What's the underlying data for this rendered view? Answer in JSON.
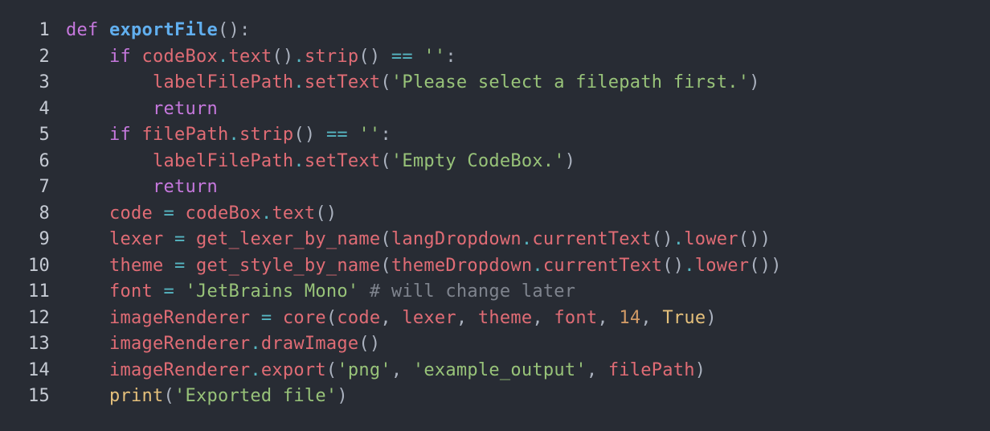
{
  "editor": {
    "language": "python",
    "theme_colors": {
      "background": "#282c34",
      "line_number": "#c5cad3",
      "keyword": "#c678dd",
      "function_def": "#61afef",
      "variable": "#e06c75",
      "punctuation": "#abb2bf",
      "operator": "#56b6c2",
      "string": "#98c379",
      "comment": "#7f848e",
      "number": "#d19a66",
      "builtin": "#e5c07b"
    },
    "lines": [
      {
        "number": "1",
        "tokens": [
          {
            "t": "def",
            "c": "kw"
          },
          {
            "t": " ",
            "c": "plain"
          },
          {
            "t": "exportFile",
            "c": "fn"
          },
          {
            "t": "():",
            "c": "punc"
          }
        ]
      },
      {
        "number": "2",
        "tokens": [
          {
            "t": "    ",
            "c": "plain"
          },
          {
            "t": "if",
            "c": "kw"
          },
          {
            "t": " ",
            "c": "plain"
          },
          {
            "t": "codeBox",
            "c": "var"
          },
          {
            "t": ".",
            "c": "op"
          },
          {
            "t": "text",
            "c": "method"
          },
          {
            "t": "()",
            "c": "punc"
          },
          {
            "t": ".",
            "c": "op"
          },
          {
            "t": "strip",
            "c": "method"
          },
          {
            "t": "()",
            "c": "punc"
          },
          {
            "t": " ",
            "c": "plain"
          },
          {
            "t": "==",
            "c": "op"
          },
          {
            "t": " ",
            "c": "plain"
          },
          {
            "t": "''",
            "c": "str"
          },
          {
            "t": ":",
            "c": "punc"
          }
        ]
      },
      {
        "number": "3",
        "tokens": [
          {
            "t": "        ",
            "c": "plain"
          },
          {
            "t": "labelFilePath",
            "c": "var"
          },
          {
            "t": ".",
            "c": "op"
          },
          {
            "t": "setText",
            "c": "method"
          },
          {
            "t": "(",
            "c": "punc"
          },
          {
            "t": "'Please select a filepath first.'",
            "c": "str"
          },
          {
            "t": ")",
            "c": "punc"
          }
        ]
      },
      {
        "number": "4",
        "tokens": [
          {
            "t": "        ",
            "c": "plain"
          },
          {
            "t": "return",
            "c": "kw"
          }
        ]
      },
      {
        "number": "5",
        "tokens": [
          {
            "t": "    ",
            "c": "plain"
          },
          {
            "t": "if",
            "c": "kw"
          },
          {
            "t": " ",
            "c": "plain"
          },
          {
            "t": "filePath",
            "c": "var"
          },
          {
            "t": ".",
            "c": "op"
          },
          {
            "t": "strip",
            "c": "method"
          },
          {
            "t": "()",
            "c": "punc"
          },
          {
            "t": " ",
            "c": "plain"
          },
          {
            "t": "==",
            "c": "op"
          },
          {
            "t": " ",
            "c": "plain"
          },
          {
            "t": "''",
            "c": "str"
          },
          {
            "t": ":",
            "c": "punc"
          }
        ]
      },
      {
        "number": "6",
        "tokens": [
          {
            "t": "        ",
            "c": "plain"
          },
          {
            "t": "labelFilePath",
            "c": "var"
          },
          {
            "t": ".",
            "c": "op"
          },
          {
            "t": "setText",
            "c": "method"
          },
          {
            "t": "(",
            "c": "punc"
          },
          {
            "t": "'Empty CodeBox.'",
            "c": "str"
          },
          {
            "t": ")",
            "c": "punc"
          }
        ]
      },
      {
        "number": "7",
        "tokens": [
          {
            "t": "        ",
            "c": "plain"
          },
          {
            "t": "return",
            "c": "kw"
          }
        ]
      },
      {
        "number": "8",
        "tokens": [
          {
            "t": "    ",
            "c": "plain"
          },
          {
            "t": "code",
            "c": "var"
          },
          {
            "t": " ",
            "c": "plain"
          },
          {
            "t": "=",
            "c": "op"
          },
          {
            "t": " ",
            "c": "plain"
          },
          {
            "t": "codeBox",
            "c": "var"
          },
          {
            "t": ".",
            "c": "op"
          },
          {
            "t": "text",
            "c": "method"
          },
          {
            "t": "()",
            "c": "punc"
          }
        ]
      },
      {
        "number": "9",
        "tokens": [
          {
            "t": "    ",
            "c": "plain"
          },
          {
            "t": "lexer",
            "c": "var"
          },
          {
            "t": " ",
            "c": "plain"
          },
          {
            "t": "=",
            "c": "op"
          },
          {
            "t": " ",
            "c": "plain"
          },
          {
            "t": "get_lexer_by_name",
            "c": "var"
          },
          {
            "t": "(",
            "c": "punc"
          },
          {
            "t": "langDropdown",
            "c": "var"
          },
          {
            "t": ".",
            "c": "op"
          },
          {
            "t": "currentText",
            "c": "method"
          },
          {
            "t": "()",
            "c": "punc"
          },
          {
            "t": ".",
            "c": "op"
          },
          {
            "t": "lower",
            "c": "method"
          },
          {
            "t": "())",
            "c": "punc"
          }
        ]
      },
      {
        "number": "10",
        "tokens": [
          {
            "t": "    ",
            "c": "plain"
          },
          {
            "t": "theme",
            "c": "var"
          },
          {
            "t": " ",
            "c": "plain"
          },
          {
            "t": "=",
            "c": "op"
          },
          {
            "t": " ",
            "c": "plain"
          },
          {
            "t": "get_style_by_name",
            "c": "var"
          },
          {
            "t": "(",
            "c": "punc"
          },
          {
            "t": "themeDropdown",
            "c": "var"
          },
          {
            "t": ".",
            "c": "op"
          },
          {
            "t": "currentText",
            "c": "method"
          },
          {
            "t": "()",
            "c": "punc"
          },
          {
            "t": ".",
            "c": "op"
          },
          {
            "t": "lower",
            "c": "method"
          },
          {
            "t": "())",
            "c": "punc"
          }
        ]
      },
      {
        "number": "11",
        "tokens": [
          {
            "t": "    ",
            "c": "plain"
          },
          {
            "t": "font",
            "c": "var"
          },
          {
            "t": " ",
            "c": "plain"
          },
          {
            "t": "=",
            "c": "op"
          },
          {
            "t": " ",
            "c": "plain"
          },
          {
            "t": "'JetBrains Mono'",
            "c": "str"
          },
          {
            "t": " ",
            "c": "plain"
          },
          {
            "t": "# will change later",
            "c": "cmt"
          }
        ]
      },
      {
        "number": "12",
        "tokens": [
          {
            "t": "    ",
            "c": "plain"
          },
          {
            "t": "imageRenderer",
            "c": "var"
          },
          {
            "t": " ",
            "c": "plain"
          },
          {
            "t": "=",
            "c": "op"
          },
          {
            "t": " ",
            "c": "plain"
          },
          {
            "t": "core",
            "c": "var"
          },
          {
            "t": "(",
            "c": "punc"
          },
          {
            "t": "code",
            "c": "var"
          },
          {
            "t": ", ",
            "c": "punc"
          },
          {
            "t": "lexer",
            "c": "var"
          },
          {
            "t": ", ",
            "c": "punc"
          },
          {
            "t": "theme",
            "c": "var"
          },
          {
            "t": ", ",
            "c": "punc"
          },
          {
            "t": "font",
            "c": "var"
          },
          {
            "t": ", ",
            "c": "punc"
          },
          {
            "t": "14",
            "c": "num"
          },
          {
            "t": ", ",
            "c": "punc"
          },
          {
            "t": "True",
            "c": "builtin"
          },
          {
            "t": ")",
            "c": "punc"
          }
        ]
      },
      {
        "number": "13",
        "tokens": [
          {
            "t": "    ",
            "c": "plain"
          },
          {
            "t": "imageRenderer",
            "c": "var"
          },
          {
            "t": ".",
            "c": "op"
          },
          {
            "t": "drawImage",
            "c": "method"
          },
          {
            "t": "()",
            "c": "punc"
          }
        ]
      },
      {
        "number": "14",
        "tokens": [
          {
            "t": "    ",
            "c": "plain"
          },
          {
            "t": "imageRenderer",
            "c": "var"
          },
          {
            "t": ".",
            "c": "op"
          },
          {
            "t": "export",
            "c": "method"
          },
          {
            "t": "(",
            "c": "punc"
          },
          {
            "t": "'png'",
            "c": "str"
          },
          {
            "t": ", ",
            "c": "punc"
          },
          {
            "t": "'example_output'",
            "c": "str"
          },
          {
            "t": ", ",
            "c": "punc"
          },
          {
            "t": "filePath",
            "c": "var"
          },
          {
            "t": ")",
            "c": "punc"
          }
        ]
      },
      {
        "number": "15",
        "tokens": [
          {
            "t": "    ",
            "c": "plain"
          },
          {
            "t": "print",
            "c": "builtin"
          },
          {
            "t": "(",
            "c": "punc"
          },
          {
            "t": "'Exported file'",
            "c": "str"
          },
          {
            "t": ")",
            "c": "punc"
          }
        ]
      }
    ]
  }
}
